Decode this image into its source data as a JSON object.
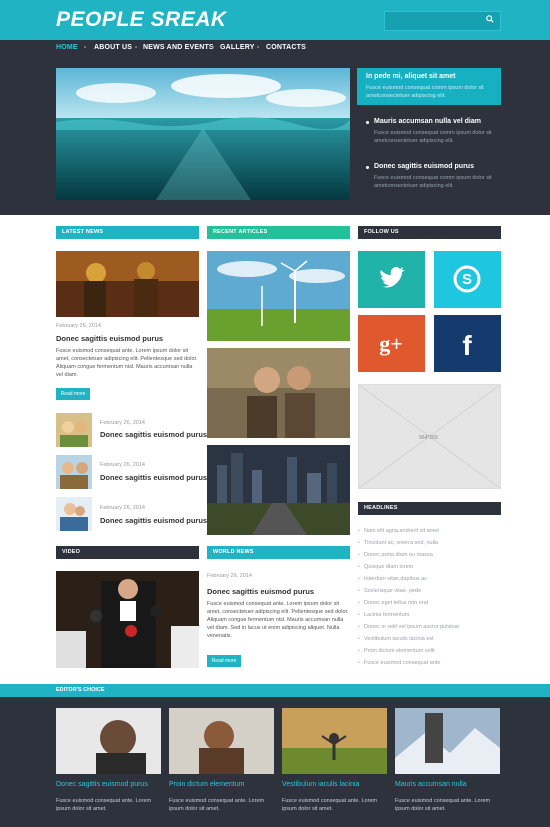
{
  "brand": {
    "logo": "PEOPLE SREAK",
    "search_icon": "magnifier"
  },
  "nav": {
    "items": [
      "HOME",
      "ABOUT US",
      "NEWS AND EVENTS",
      "GALLERY",
      "CONTACTS"
    ]
  },
  "hero": {
    "items": [
      {
        "title": "In pede mi, aliquet sit amet",
        "text": "Fusce euismod consequat comm ipsum dolor sit ametconsectetuer adipiscing elit."
      },
      {
        "title": "Mauris accumsan nulla vel diam",
        "text": "Fusce euismod consequat comm ipsum dolor sit ametconsectetuer adipiscing elit."
      },
      {
        "title": "Donec sagittis euismod purus",
        "text": "Fusce euismod consequat comm ipsum dolor sit ametconsectetuer adipiscing elit."
      }
    ]
  },
  "sections": {
    "latest_news": "LATEST NEWS",
    "recent_articles": "RECENT ARTICLES",
    "follow_us": "FOLLOW US",
    "video": "VIDEO",
    "world_news": "WORLD NEWS",
    "headlines": "HEADLINES",
    "editors_choice": "EDITOR'S CHOICE"
  },
  "latest_news": {
    "main": {
      "date": "February 26, 2014",
      "title": "Donec sagittis euismod purus",
      "text": "Fusce euismod consequat ante. Lorem ipsum dolor sit amet, consectetuer adipiscing elit. Pellentesque sed dolor. Aliquam congue fermentum nisl. Mauris accumsan nulla vel diam.",
      "button": "Read more"
    },
    "small": [
      {
        "date": "February 26, 2014",
        "title": "Donec sagittis euismod purus"
      },
      {
        "date": "February 26, 2014",
        "title": "Donec sagittis euismod purus"
      },
      {
        "date": "February 26, 2014",
        "title": "Donec sagittis euismod purus"
      }
    ]
  },
  "social": {
    "twitter": "t",
    "skype": "S",
    "google": "g+",
    "facebook": "f"
  },
  "ad": {
    "label": "964*269"
  },
  "headlines": [
    "Nam elit agna,endrerit sit amet",
    "Tincidunt ac, viverra sed, nulla",
    "Donec porta diam eu massa",
    "Quisque diam lorem",
    "Interdum vitae,dapibus ac",
    "Scelerisque vitae, pede",
    "Donec eget tellus non erat",
    "Lacinia fermentum",
    "Donec in velit vel ipsum auctor pulvinar",
    "Vestibulum iaculis lacinia est",
    "Proin dictum elementum velit",
    "Fusce euismod consequat ante"
  ],
  "world_news": {
    "date": "February 26, 2014",
    "title": "Donec sagittis euismod purus",
    "text": "Fusce euismod consequat ante. Lorem ipsum dolor sit amet, consectetuer adipiscing elit. Pellentesque sed dolor. Aliquam congue fermentum nisl. Mauris accumsan nulla vel diam. Sed in lacus ut enim adipiscing aliquet. Nulla venenatis.",
    "button": "Read more"
  },
  "editors": [
    {
      "title": "Donec sagittis euismod purus",
      "text": "Fusce euismod consequat ante. Lorem ipsum dolor sit amet."
    },
    {
      "title": "Proin dictum elementum",
      "text": "Fusce euismod consequat ante. Lorem ipsum dolor sit amet."
    },
    {
      "title": "Vestibulum iaculis lacinia",
      "text": "Fusce euismod consequat ante. Lorem ipsum dolor sit amet."
    },
    {
      "title": "Mauris accumsan nulla",
      "text": "Fusce euismod consequat ante. Lorem ipsum dolor sit amet."
    }
  ]
}
